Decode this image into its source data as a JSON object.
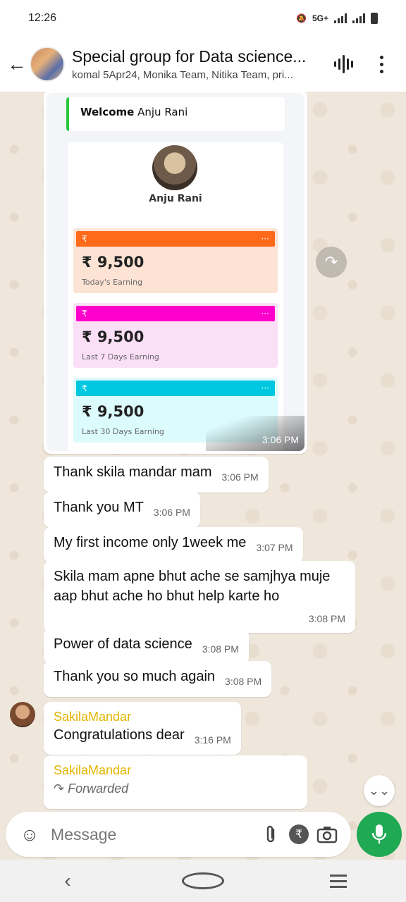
{
  "status_bar": {
    "time": "12:26",
    "network": "5G+"
  },
  "header": {
    "title": "Special group for Data science...",
    "subtitle": "komal 5Apr24, Monika Team, Nitika Team, pri..."
  },
  "image_message": {
    "welcome_prefix": "Welcome",
    "welcome_name": "Anju Rani",
    "profile_name": "Anju Rani",
    "cards": [
      {
        "currency": "₹",
        "amount": "₹ 9,500",
        "label": "Today's Earning",
        "color": "#ff6a1a",
        "bg": "#fde3d4"
      },
      {
        "currency": "₹",
        "amount": "₹ 9,500",
        "label": "Last 7 Days Earning",
        "color": "#ff00cc",
        "bg": "#fbdff7"
      },
      {
        "currency": "₹",
        "amount": "₹ 9,500",
        "label": "Last 30 Days Earning",
        "color": "#00c8e0",
        "bg": "#dcfbfd"
      }
    ],
    "time": "3:06 PM"
  },
  "messages": [
    {
      "text": "Thank skila mandar mam",
      "time": "3:06 PM"
    },
    {
      "text": "Thank you MT",
      "time": "3:06 PM"
    },
    {
      "text": "My first income only 1week me",
      "time": "3:07 PM"
    },
    {
      "text": "Skila mam apne bhut ache se samjhya muje aap bhut ache ho bhut help karte ho",
      "time": "3:08 PM"
    },
    {
      "text": "Power of data science",
      "time": "3:08 PM"
    },
    {
      "text": "Thank you so much again",
      "time": "3:08 PM"
    },
    {
      "sender": "SakilaMandar",
      "text": "Congratulations dear",
      "time": "3:16 PM"
    },
    {
      "sender": "SakilaMandar",
      "forwarded_label": "Forwarded"
    }
  ],
  "input": {
    "placeholder": "Message"
  },
  "icons": {
    "back": "back-arrow-icon",
    "voice": "audio-wave-icon",
    "menu": "more-vertical-icon",
    "emoji": "emoji-icon",
    "attach": "paperclip-icon",
    "payment": "rupee-icon",
    "camera": "camera-icon",
    "mic": "microphone-icon"
  },
  "colors": {
    "accent_green": "#1ea952",
    "sender_name": "#e3b400"
  }
}
